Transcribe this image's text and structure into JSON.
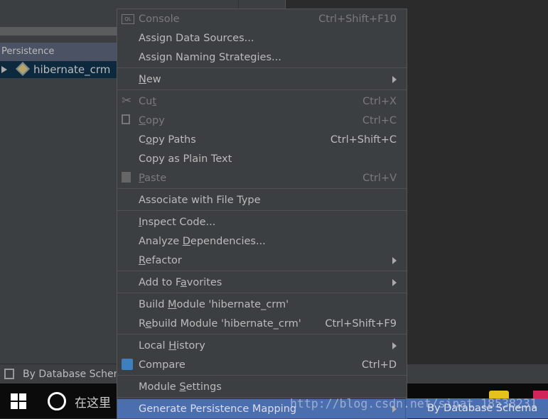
{
  "tool_window": {
    "title": "Persistence",
    "tree_item": "hibernate_crm"
  },
  "status_bar": {
    "text": "By Database Schema"
  },
  "taskbar": {
    "search_text": "在这里"
  },
  "menu": {
    "items": [
      {
        "type": "item",
        "pre": "Console",
        "mn": "",
        "post": "",
        "shortcut": "Ctrl+Shift+F10",
        "disabled": true,
        "icon": "sql-console-icon"
      },
      {
        "type": "item",
        "pre": "Assign Data Sources...",
        "mn": "",
        "post": "",
        "shortcut": ""
      },
      {
        "type": "item",
        "pre": "Assign Naming Strategies...",
        "mn": "",
        "post": "",
        "shortcut": ""
      },
      {
        "type": "sep"
      },
      {
        "type": "item",
        "pre": "",
        "mn": "N",
        "post": "ew",
        "shortcut": "",
        "submenu": true
      },
      {
        "type": "sep"
      },
      {
        "type": "item",
        "pre": "Cu",
        "mn": "t",
        "post": "",
        "shortcut": "Ctrl+X",
        "disabled": true,
        "icon": "scissors-icon"
      },
      {
        "type": "item",
        "pre": "",
        "mn": "C",
        "post": "opy",
        "shortcut": "Ctrl+C",
        "disabled": true,
        "icon": "copy-icon"
      },
      {
        "type": "item",
        "pre": "C",
        "mn": "o",
        "post": "py Paths",
        "shortcut": "Ctrl+Shift+C"
      },
      {
        "type": "item",
        "pre": "Copy as Plain Text",
        "mn": "",
        "post": "",
        "shortcut": ""
      },
      {
        "type": "item",
        "pre": "",
        "mn": "P",
        "post": "aste",
        "shortcut": "Ctrl+V",
        "disabled": true,
        "icon": "paste-icon"
      },
      {
        "type": "sep"
      },
      {
        "type": "item",
        "pre": "Associate with File Type",
        "mn": "",
        "post": "",
        "shortcut": ""
      },
      {
        "type": "sep"
      },
      {
        "type": "item",
        "pre": "",
        "mn": "I",
        "post": "nspect Code...",
        "shortcut": ""
      },
      {
        "type": "item",
        "pre": "Analyze ",
        "mn": "D",
        "post": "ependencies...",
        "shortcut": ""
      },
      {
        "type": "item",
        "pre": "",
        "mn": "R",
        "post": "efactor",
        "shortcut": "",
        "submenu": true
      },
      {
        "type": "sep"
      },
      {
        "type": "item",
        "pre": "Add to F",
        "mn": "a",
        "post": "vorites",
        "shortcut": "",
        "submenu": true
      },
      {
        "type": "sep"
      },
      {
        "type": "item",
        "pre": "Build ",
        "mn": "M",
        "post": "odule 'hibernate_crm'",
        "shortcut": ""
      },
      {
        "type": "item",
        "pre": "R",
        "mn": "e",
        "post": "build Module 'hibernate_crm'",
        "shortcut": "Ctrl+Shift+F9"
      },
      {
        "type": "sep"
      },
      {
        "type": "item",
        "pre": "Local ",
        "mn": "H",
        "post": "istory",
        "shortcut": "",
        "submenu": true
      },
      {
        "type": "item",
        "pre": "Compare",
        "mn": "",
        "post": "",
        "shortcut": "Ctrl+D",
        "icon": "compare-icon"
      },
      {
        "type": "sep"
      },
      {
        "type": "item",
        "pre": "Module ",
        "mn": "S",
        "post": "ettings",
        "shortcut": ""
      },
      {
        "type": "sep"
      },
      {
        "type": "item",
        "pre": "Generate Persistence Mapping",
        "mn": "",
        "post": "",
        "shortcut": "",
        "submenu": true,
        "highlighted": true
      }
    ]
  },
  "submenu": {
    "items": [
      "By Database Schema"
    ]
  },
  "colors": {
    "menu_bg": "#3c3f41",
    "highlight": "#4b6eaf",
    "text": "#bbbbbb",
    "disabled": "#7a7a7a"
  }
}
